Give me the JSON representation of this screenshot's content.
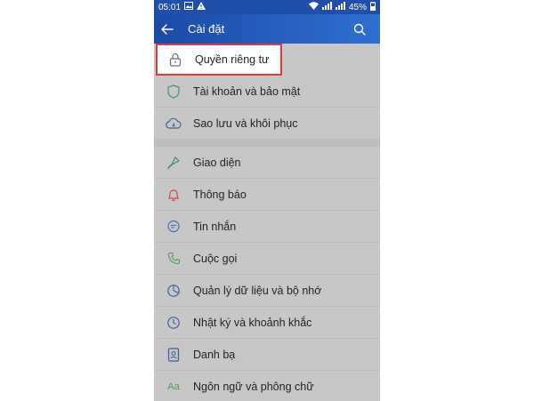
{
  "status_bar": {
    "time": "05:01",
    "battery": "45%"
  },
  "app_bar": {
    "title": "Cài đặt",
    "back_icon": "arrow-left-icon",
    "search_icon": "search-icon"
  },
  "settings": {
    "group1": [
      {
        "label": "Quyền riêng tư",
        "icon": "lock-icon",
        "highlighted": true
      },
      {
        "label": "Tài khoản và bảo mật",
        "icon": "shield-icon"
      },
      {
        "label": "Sao lưu và khôi phục",
        "icon": "cloud-icon"
      }
    ],
    "group2": [
      {
        "label": "Giao diện",
        "icon": "paint-brush-icon"
      },
      {
        "label": "Thông báo",
        "icon": "bell-icon"
      },
      {
        "label": "Tin nhắn",
        "icon": "chat-bubble-icon"
      },
      {
        "label": "Cuộc gọi",
        "icon": "phone-icon"
      },
      {
        "label": "Quản lý dữ liệu và bộ nhớ",
        "icon": "pie-chart-icon"
      },
      {
        "label": "Nhật ký và khoảnh khắc",
        "icon": "clock-icon"
      },
      {
        "label": "Danh bạ",
        "icon": "contacts-icon"
      },
      {
        "label": "Ngôn ngữ và phông chữ",
        "icon": "font-icon",
        "icon_text": "Aa"
      }
    ]
  },
  "colors": {
    "appbar_start": "#1b4aa6",
    "appbar_end": "#2f6fd1",
    "highlight_border": "#e03a3a",
    "overlay_background": "#c7c7c7"
  }
}
